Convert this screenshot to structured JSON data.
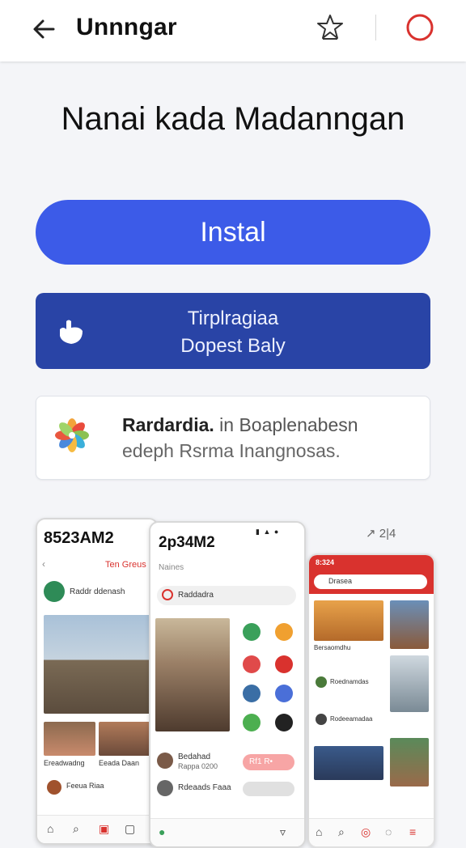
{
  "header": {
    "title": "Unnngar",
    "back_icon": "arrow-left-icon",
    "bookmark_icon": "star-outline-icon",
    "profile_icon": "circle-icon"
  },
  "headline": "Nanai kada Madanngan",
  "install_label": "Instal",
  "promo": {
    "line1": "Tirplragiaa",
    "line2": "Dopest Baly",
    "icon": "hand-icon"
  },
  "info": {
    "title": "Rardardia.",
    "rest1": "in Boaplenabesn",
    "line2": "edeph Rsrma Inangnosas.",
    "icon": "flower-icon"
  },
  "rating_text": "↗ 2|4",
  "screens": {
    "s1": {
      "time": "8523AM2",
      "label_red": "Ten Greus",
      "profile": "Raddr ddenash",
      "cap1": "Ereadwadng",
      "cap2": "Eeada Daan",
      "row": "Feeua Riaa"
    },
    "s2": {
      "time": "2p34M2",
      "subtitle": "Naines",
      "search": "Raddadra",
      "row1": "Bedahad",
      "row1b": "Rappa 0200",
      "row2": "Rdeaads Faaa",
      "pill": "Rf1 R•"
    },
    "s3": {
      "time": "8:324",
      "search": "Drasea",
      "item1": "Bersaomdhu",
      "item2": "Roednamdas",
      "item3": "Rodeeamadaa"
    }
  },
  "colors": {
    "accent_blue": "#3c5be8",
    "promo_blue": "#2944a6",
    "red": "#d9322e"
  }
}
